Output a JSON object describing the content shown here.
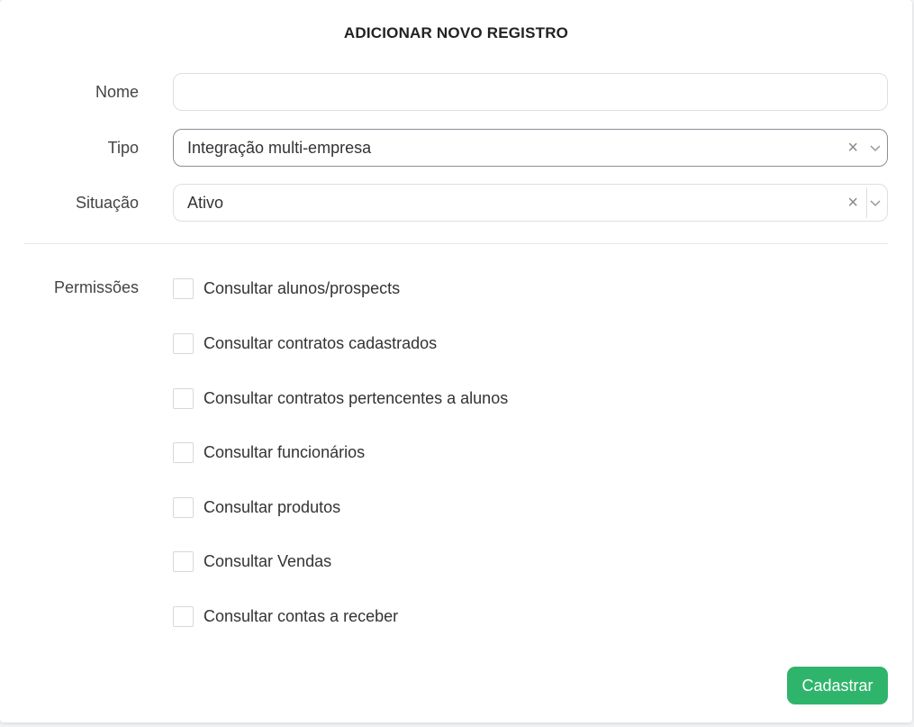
{
  "form": {
    "title": "ADICIONAR NOVO REGISTRO",
    "nome": {
      "label": "Nome",
      "value": "",
      "placeholder": ""
    },
    "tipo": {
      "label": "Tipo",
      "value": "Integração multi-empresa",
      "clear_symbol": "×",
      "icon": "chevron-down-icon"
    },
    "situacao": {
      "label": "Situação",
      "value": "Ativo",
      "clear_symbol": "×",
      "icon": "chevron-down-icon"
    },
    "permissoes": {
      "label": "Permissões",
      "items": [
        {
          "label": "Consultar alunos/prospects",
          "checked": false
        },
        {
          "label": "Consultar contratos cadastrados",
          "checked": false
        },
        {
          "label": "Consultar contratos pertencentes a alunos",
          "checked": false
        },
        {
          "label": "Consultar funcionários",
          "checked": false
        },
        {
          "label": "Consultar produtos",
          "checked": false
        },
        {
          "label": "Consultar Vendas",
          "checked": false
        },
        {
          "label": "Consultar contas a receber",
          "checked": false
        }
      ]
    },
    "submit_label": "Cadastrar"
  },
  "colors": {
    "primary_button": "#2fb56b",
    "border": "#dcdfe4",
    "focused_border": "#8a8f96"
  }
}
